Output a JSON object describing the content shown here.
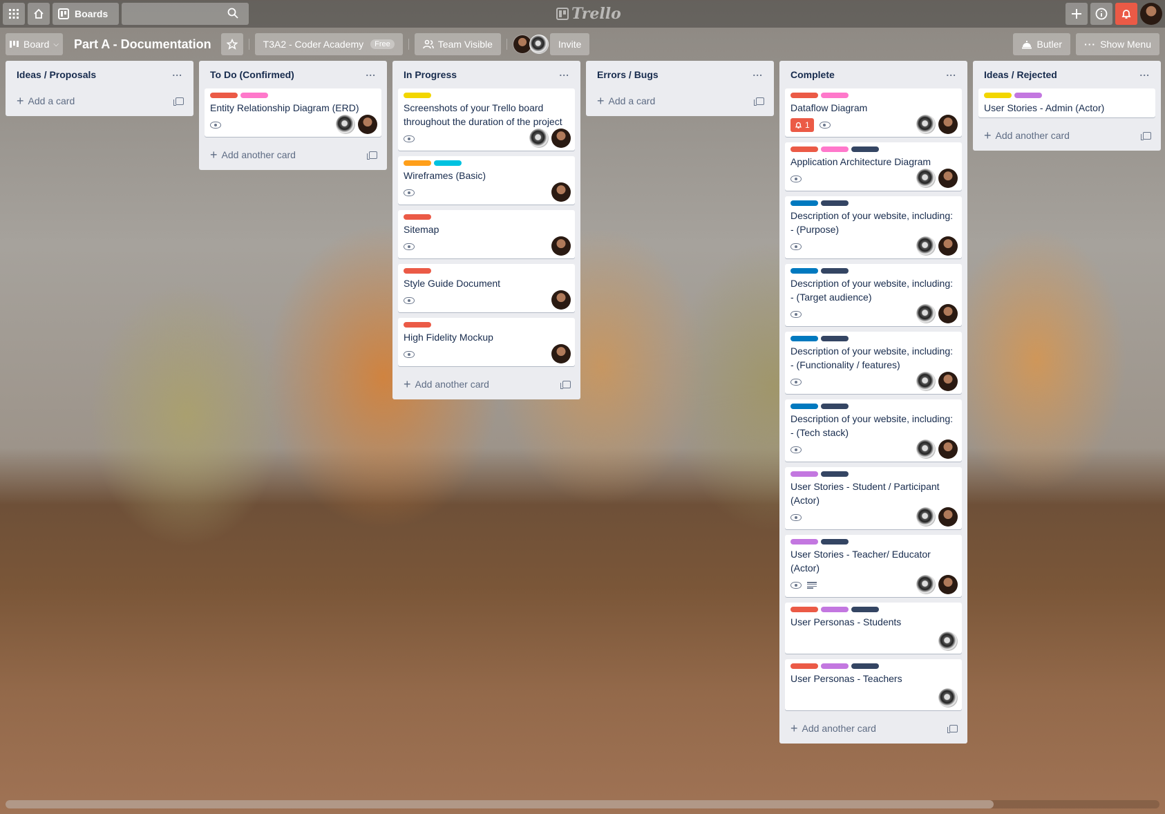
{
  "header": {
    "boards_label": "Boards",
    "search_placeholder": "",
    "logo_text": "Trello"
  },
  "board": {
    "view_label": "Board",
    "title": "Part A - Documentation",
    "workspace": "T3A2 - Coder Academy",
    "workspace_badge": "Free",
    "visibility": "Team Visible",
    "invite_label": "Invite",
    "butler_label": "Butler",
    "show_menu_label": "Show Menu"
  },
  "colors": {
    "red": "#eb5a46",
    "pink": "#ff78cb",
    "yellow": "#f2d600",
    "orange": "#ff9f1a",
    "sky": "#00c2e0",
    "blue": "#0079bf",
    "black": "#344563",
    "purple": "#c377e0"
  },
  "lists": [
    {
      "title": "Ideas / Proposals",
      "add_label": "Add a card",
      "cards": []
    },
    {
      "title": "To Do (Confirmed)",
      "add_label": "Add another card",
      "cards": [
        {
          "title": "Entity Relationship Diagram (ERD)",
          "labels": [
            "red",
            "pink"
          ],
          "members": [
            "b",
            "a"
          ]
        }
      ]
    },
    {
      "title": "In Progress",
      "add_label": "Add another card",
      "cards": [
        {
          "title": "Screenshots of your Trello board throughout the duration of the project",
          "labels": [
            "yellow"
          ],
          "members": [
            "b",
            "a"
          ]
        },
        {
          "title": "Wireframes (Basic)",
          "labels": [
            "orange",
            "sky"
          ],
          "members": [
            "a"
          ]
        },
        {
          "title": "Sitemap",
          "labels": [
            "red"
          ],
          "members": [
            "a"
          ]
        },
        {
          "title": "Style Guide Document",
          "labels": [
            "red"
          ],
          "members": [
            "a"
          ]
        },
        {
          "title": "High Fidelity Mockup",
          "labels": [
            "red"
          ],
          "members": [
            "a"
          ]
        }
      ]
    },
    {
      "title": "Errors / Bugs",
      "add_label": "Add a card",
      "cards": []
    },
    {
      "title": "Complete",
      "add_label": "Add another card",
      "cards": [
        {
          "title": "Dataflow Diagram",
          "labels": [
            "red",
            "pink"
          ],
          "members": [
            "b",
            "a"
          ],
          "due": "1"
        },
        {
          "title": "Application Architecture Diagram",
          "labels": [
            "red",
            "pink",
            "black"
          ],
          "members": [
            "b",
            "a"
          ]
        },
        {
          "title": "Description of your website, including: - (Purpose)",
          "labels": [
            "blue",
            "black"
          ],
          "members": [
            "b",
            "a"
          ]
        },
        {
          "title": "Description of your website, including: - (Target audience)",
          "labels": [
            "blue",
            "black"
          ],
          "members": [
            "b",
            "a"
          ]
        },
        {
          "title": "Description of your website, including: - (Functionality / features)",
          "labels": [
            "blue",
            "black"
          ],
          "members": [
            "b",
            "a"
          ]
        },
        {
          "title": "Description of your website, including: - (Tech stack)",
          "labels": [
            "blue",
            "black"
          ],
          "members": [
            "b",
            "a"
          ]
        },
        {
          "title": "User Stories - Student / Participant (Actor)",
          "labels": [
            "purple",
            "black"
          ],
          "members": [
            "b",
            "a"
          ]
        },
        {
          "title": "User Stories - Teacher/ Educator (Actor)",
          "labels": [
            "purple",
            "black"
          ],
          "members": [
            "b",
            "a"
          ],
          "desc": true
        },
        {
          "title": "User Personas - Students",
          "labels": [
            "red",
            "purple",
            "black"
          ],
          "members": [
            "b"
          ],
          "noWatch": true
        },
        {
          "title": "User Personas - Teachers",
          "labels": [
            "red",
            "purple",
            "black"
          ],
          "members": [
            "b"
          ],
          "noWatch": true
        }
      ]
    },
    {
      "title": "Ideas / Rejected",
      "add_label": "Add another card",
      "cards": [
        {
          "title": "User Stories - Admin (Actor)",
          "labels": [
            "yellow",
            "purple"
          ],
          "members": [],
          "noWatch": true
        }
      ]
    }
  ]
}
